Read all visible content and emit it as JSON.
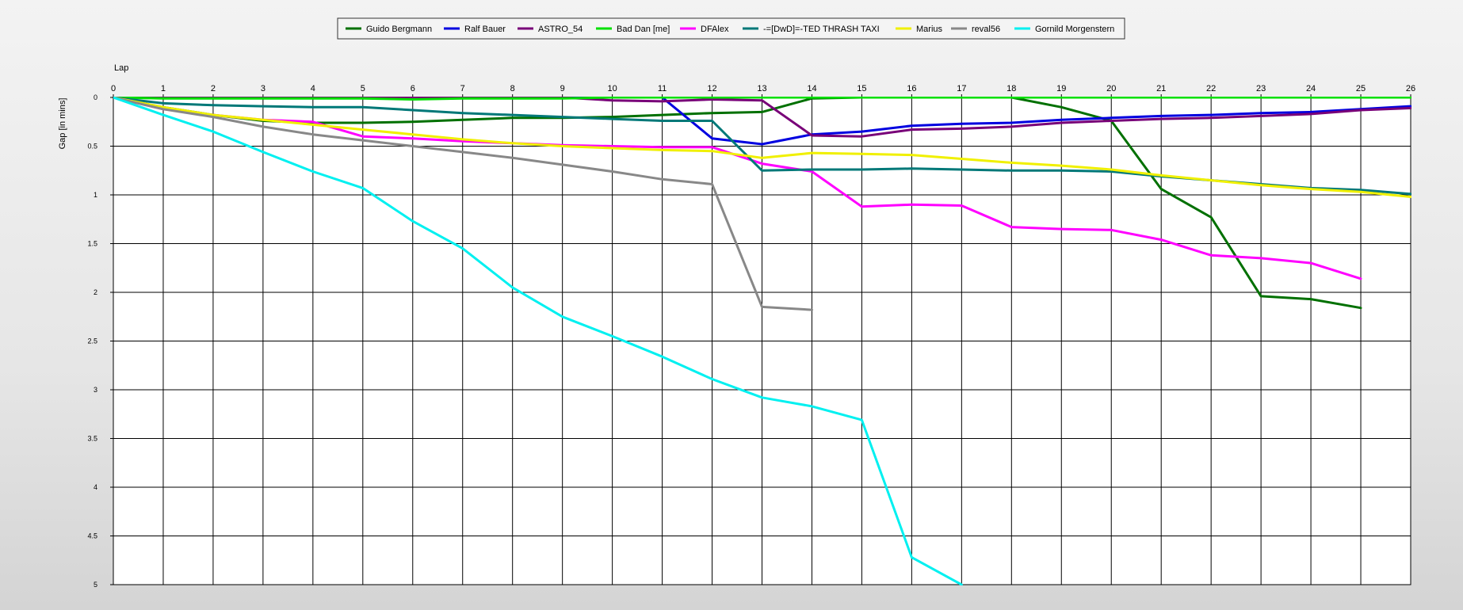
{
  "chart_data": {
    "type": "line",
    "xlabel": "Lap",
    "ylabel": "Gap [in mins]",
    "x_axis_position": "top",
    "y_axis_inverted": true,
    "xlim": [
      0,
      26
    ],
    "ylim": [
      0,
      5
    ],
    "x_ticks": [
      0,
      1,
      2,
      3,
      4,
      5,
      6,
      7,
      8,
      9,
      10,
      11,
      12,
      13,
      14,
      15,
      16,
      17,
      18,
      19,
      20,
      21,
      22,
      23,
      24,
      25,
      26
    ],
    "y_ticks": [
      0,
      0.5,
      1,
      1.5,
      2,
      2.5,
      3,
      3.5,
      4,
      4.5,
      5
    ],
    "y_tick_labels": [
      "0",
      "0.5",
      "1",
      "1.5",
      "2",
      "2.5",
      "3",
      "3.5",
      "4",
      "4.5",
      "5"
    ],
    "grid": true,
    "legend_position": "top-center",
    "plot_background": "#ffffff",
    "series": [
      {
        "name": "Guido Bergmann",
        "color": "#007000",
        "x": [
          0,
          1,
          2,
          3,
          4,
          5,
          6,
          7,
          8,
          9,
          10,
          11,
          12,
          13,
          14,
          15,
          16,
          17,
          18,
          19,
          20,
          21,
          22,
          23,
          24,
          25
        ],
        "y": [
          0,
          0.1,
          0.18,
          0.24,
          0.26,
          0.26,
          0.25,
          0.23,
          0.21,
          0.21,
          0.2,
          0.18,
          0.16,
          0.15,
          0.01,
          0,
          0,
          0,
          0,
          0.1,
          0.24,
          0.94,
          1.23,
          2.04,
          2.07,
          2.16
        ]
      },
      {
        "name": "Ralf Bauer",
        "color": "#0000e0",
        "x": [
          0,
          1,
          2,
          3,
          4,
          5,
          6,
          7,
          8,
          9,
          10,
          11,
          12,
          13,
          14,
          15,
          16,
          17,
          18,
          19,
          20,
          21,
          22,
          23,
          24,
          25,
          26
        ],
        "y": [
          0,
          0,
          0,
          0,
          0,
          0,
          0,
          0,
          0,
          0,
          0,
          0,
          0.42,
          0.48,
          0.38,
          0.35,
          0.29,
          0.27,
          0.26,
          0.23,
          0.21,
          0.19,
          0.18,
          0.16,
          0.15,
          0.12,
          0.09
        ]
      },
      {
        "name": "ASTRO_54",
        "color": "#780078",
        "x": [
          0,
          1,
          2,
          3,
          4,
          5,
          6,
          7,
          8,
          9,
          10,
          11,
          12,
          13,
          14,
          15,
          16,
          17,
          18,
          19,
          20,
          21,
          22,
          23,
          24,
          25,
          26
        ],
        "y": [
          0,
          0,
          0,
          0,
          0,
          0,
          0,
          0,
          0,
          0,
          0.03,
          0.04,
          0.02,
          0.03,
          0.39,
          0.4,
          0.33,
          0.32,
          0.3,
          0.26,
          0.24,
          0.22,
          0.21,
          0.19,
          0.17,
          0.13,
          0.11
        ]
      },
      {
        "name": "Bad Dan [me]",
        "color": "#00e000",
        "x": [
          0,
          1,
          2,
          3,
          4,
          5,
          6,
          7,
          8,
          9,
          10,
          11,
          12,
          13,
          14,
          15,
          16,
          17,
          18,
          19,
          20,
          21,
          22,
          23,
          24,
          25,
          26
        ],
        "y": [
          0,
          0.01,
          0.01,
          0.01,
          0.01,
          0.01,
          0.02,
          0.01,
          0.01,
          0.01,
          0,
          0,
          0,
          0,
          0,
          0,
          0,
          0,
          0,
          0,
          0,
          0,
          0,
          0,
          0,
          0,
          0
        ]
      },
      {
        "name": "DFAlex",
        "color": "#ff00ff",
        "x": [
          0,
          1,
          2,
          3,
          4,
          5,
          6,
          7,
          8,
          9,
          10,
          11,
          12,
          13,
          14,
          15,
          16,
          17,
          18,
          19,
          20,
          21,
          22,
          23,
          24,
          25
        ],
        "y": [
          0,
          0.12,
          0.18,
          0.23,
          0.25,
          0.4,
          0.42,
          0.45,
          0.47,
          0.49,
          0.5,
          0.51,
          0.51,
          0.68,
          0.76,
          1.12,
          1.1,
          1.11,
          1.33,
          1.35,
          1.36,
          1.46,
          1.62,
          1.65,
          1.7,
          1.86
        ]
      },
      {
        "name": "-=[DwD]=-TED THRASH TAXI",
        "color": "#007878",
        "x": [
          0,
          1,
          2,
          3,
          4,
          5,
          6,
          7,
          8,
          9,
          10,
          11,
          12,
          13,
          14,
          15,
          16,
          17,
          18,
          19,
          20,
          21,
          22,
          23,
          24,
          25,
          26
        ],
        "y": [
          0,
          0.06,
          0.08,
          0.09,
          0.1,
          0.1,
          0.13,
          0.16,
          0.18,
          0.2,
          0.22,
          0.24,
          0.24,
          0.75,
          0.74,
          0.74,
          0.73,
          0.74,
          0.75,
          0.75,
          0.76,
          0.81,
          0.85,
          0.89,
          0.93,
          0.95,
          0.99
        ]
      },
      {
        "name": "Marius",
        "color": "#f0f000",
        "x": [
          0,
          1,
          2,
          3,
          4,
          5,
          6,
          7,
          8,
          9,
          10,
          11,
          12,
          13,
          14,
          15,
          16,
          17,
          18,
          19,
          20,
          21,
          22,
          23,
          24,
          25,
          26
        ],
        "y": [
          0,
          0.1,
          0.18,
          0.23,
          0.28,
          0.33,
          0.38,
          0.43,
          0.47,
          0.5,
          0.52,
          0.54,
          0.55,
          0.62,
          0.57,
          0.58,
          0.59,
          0.63,
          0.67,
          0.7,
          0.74,
          0.8,
          0.85,
          0.9,
          0.94,
          0.97,
          1.02
        ]
      },
      {
        "name": "reval56",
        "color": "#888888",
        "x": [
          0,
          1,
          2,
          3,
          4,
          5,
          6,
          7,
          8,
          9,
          10,
          11,
          12,
          13,
          14
        ],
        "y": [
          0,
          0.12,
          0.2,
          0.3,
          0.38,
          0.44,
          0.5,
          0.56,
          0.62,
          0.69,
          0.76,
          0.84,
          0.89,
          2.15,
          2.18
        ]
      },
      {
        "name": "Gornild Morgenstern",
        "color": "#00f0f0",
        "x": [
          0,
          1,
          2,
          3,
          4,
          5,
          6,
          7,
          8,
          9,
          10,
          11,
          12,
          13,
          14,
          15,
          16,
          17
        ],
        "y": [
          0,
          0.18,
          0.35,
          0.56,
          0.76,
          0.93,
          1.27,
          1.55,
          1.95,
          2.25,
          2.45,
          2.66,
          2.89,
          3.08,
          3.17,
          3.31,
          4.72,
          5.0
        ]
      }
    ]
  }
}
